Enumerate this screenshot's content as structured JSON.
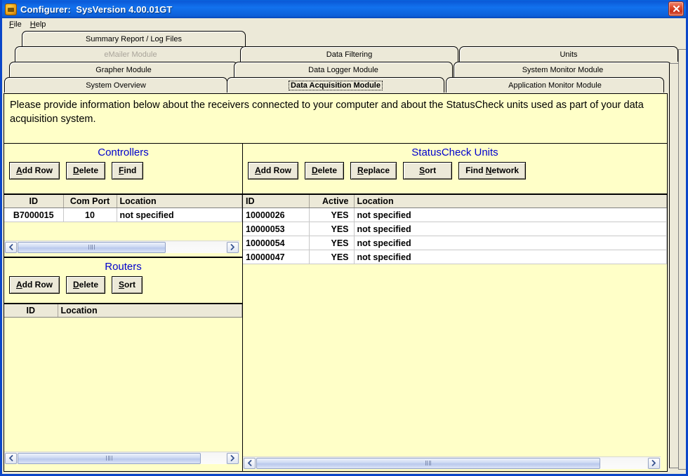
{
  "window": {
    "title": "Configurer:  SysVersion 4.00.01GT",
    "icon": "app-orange-icon",
    "close_label": "close-icon",
    "border_color": "#0a46c8"
  },
  "menu": {
    "items": [
      {
        "label": "File",
        "mnemonic": "F"
      },
      {
        "label": "Help",
        "mnemonic": "H"
      }
    ]
  },
  "tabs": {
    "rows": [
      [
        {
          "label": "Summary Report / Log Files",
          "state": "normal"
        }
      ],
      [
        {
          "label": "eMailer Module",
          "state": "disabled"
        },
        {
          "label": "Data Filtering",
          "state": "normal"
        },
        {
          "label": "Units",
          "state": "normal"
        }
      ],
      [
        {
          "label": "Grapher Module",
          "state": "normal"
        },
        {
          "label": "Data Logger Module",
          "state": "normal"
        },
        {
          "label": "System Monitor Module",
          "state": "normal"
        }
      ],
      [
        {
          "label": "System Overview",
          "state": "normal"
        },
        {
          "label": "Data Acquisition Module",
          "state": "selected"
        },
        {
          "label": "Application Monitor Module",
          "state": "normal"
        }
      ]
    ]
  },
  "intro": {
    "text": "Please provide information below about the receivers connected to your computer and about the StatusCheck units used as part of your data acquisition system."
  },
  "controllers": {
    "title": "Controllers",
    "title_color": "#0000cd",
    "buttons": [
      {
        "label": "Add Row",
        "mnemonic": "A"
      },
      {
        "label": "Delete",
        "mnemonic": "D"
      },
      {
        "label": "Find",
        "mnemonic": "F"
      }
    ],
    "columns": [
      "ID",
      "Com Port",
      "Location"
    ],
    "rows": [
      {
        "id": "B7000015",
        "com_port": "10",
        "location": "not specified"
      }
    ]
  },
  "routers": {
    "title": "Routers",
    "title_color": "#0000cd",
    "buttons": [
      {
        "label": "Add Row",
        "mnemonic": "A"
      },
      {
        "label": "Delete",
        "mnemonic": "D"
      },
      {
        "label": "Sort",
        "mnemonic": "S"
      }
    ],
    "columns": [
      "ID",
      "Location"
    ],
    "rows": []
  },
  "statuscheck": {
    "title": "StatusCheck Units",
    "title_color": "#0000cd",
    "buttons": [
      {
        "label": "Add Row",
        "mnemonic": "A"
      },
      {
        "label": "Delete",
        "mnemonic": "D"
      },
      {
        "label": "Replace",
        "mnemonic": "R"
      },
      {
        "label": "Sort",
        "mnemonic": "S"
      },
      {
        "label": "Find Network",
        "mnemonic": "N"
      }
    ],
    "columns": [
      "ID",
      "Active",
      "Location"
    ],
    "rows": [
      {
        "id": "10000026",
        "active": "YES",
        "location": "not specified"
      },
      {
        "id": "10000053",
        "active": "YES",
        "location": "not specified"
      },
      {
        "id": "10000054",
        "active": "YES",
        "location": "not specified"
      },
      {
        "id": "10000047",
        "active": "YES",
        "location": "not specified"
      }
    ]
  },
  "scrollbars": {
    "left_arrow": "chevron-left-icon",
    "right_arrow": "chevron-right-icon",
    "controllers_thumb_pct": 71,
    "routers_thumb_pct": 88,
    "statuscheck_thumb_pct": 88
  }
}
